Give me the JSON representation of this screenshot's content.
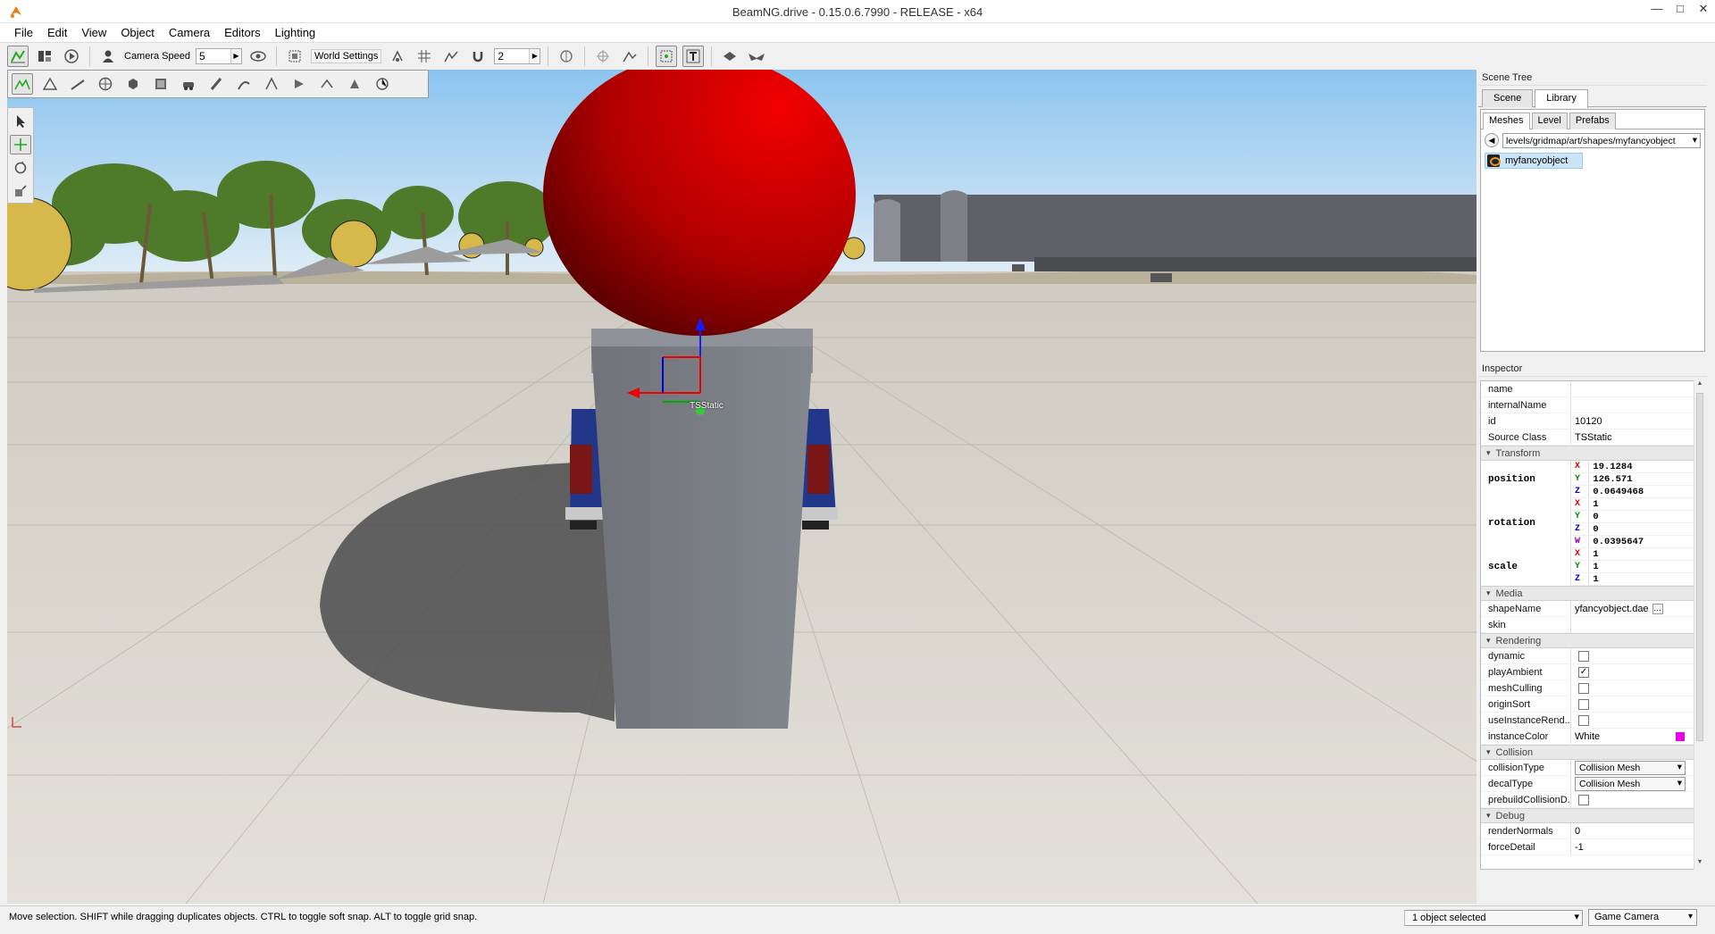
{
  "window": {
    "title": "BeamNG.drive - 0.15.0.6.7990 - RELEASE - x64",
    "controls": [
      "—",
      "□",
      "✕"
    ]
  },
  "menu": {
    "items": [
      "File",
      "Edit",
      "View",
      "Object",
      "Camera",
      "Editors",
      "Lighting"
    ]
  },
  "toolbar": {
    "camera_speed_label": "Camera Speed",
    "camera_speed_value": "5",
    "world_settings_label": "World Settings",
    "snap_value": "2"
  },
  "viewport": {
    "selection_label": "TSStatic"
  },
  "scene_tree": {
    "header": "Scene Tree",
    "tabs": [
      "Scene",
      "Library"
    ],
    "active_tab": "Library",
    "subtabs": [
      "Meshes",
      "Level",
      "Prefabs"
    ],
    "active_subtab": "Meshes",
    "path": "levels/gridmap/art/shapes/myfancyobject",
    "items": [
      "myfancyobject"
    ]
  },
  "inspector": {
    "header": "Inspector",
    "fields": {
      "name": {
        "label": "name",
        "value": ""
      },
      "internalName": {
        "label": "internalName",
        "value": ""
      },
      "id": {
        "label": "id",
        "value": "10120"
      },
      "sourceClass": {
        "label": "Source Class",
        "value": "TSStatic"
      }
    },
    "transform": {
      "group": "Transform",
      "position": {
        "label": "position",
        "x": "19.1284",
        "y": "126.571",
        "z": "0.0649468"
      },
      "rotation": {
        "label": "rotation",
        "x": "1",
        "y": "0",
        "z": "0",
        "w": "0.0395647"
      },
      "scale": {
        "label": "scale",
        "x": "1",
        "y": "1",
        "z": "1"
      }
    },
    "media": {
      "group": "Media",
      "shapeName": {
        "label": "shapeName",
        "value": "yfancyobject.dae"
      },
      "skin": {
        "label": "skin",
        "value": ""
      }
    },
    "rendering": {
      "group": "Rendering",
      "dynamic": {
        "label": "dynamic",
        "checked": false
      },
      "playAmbient": {
        "label": "playAmbient",
        "checked": true
      },
      "meshCulling": {
        "label": "meshCulling",
        "checked": false
      },
      "originSort": {
        "label": "originSort",
        "checked": false
      },
      "useInstanceRend": {
        "label": "useInstanceRend...",
        "checked": false
      },
      "instanceColor": {
        "label": "instanceColor",
        "value": "White",
        "swatch": "#e600e6"
      }
    },
    "collision": {
      "group": "Collision",
      "collisionType": {
        "label": "collisionType",
        "value": "Collision Mesh"
      },
      "decalType": {
        "label": "decalType",
        "value": "Collision Mesh"
      },
      "prebuildCollisionD": {
        "label": "prebuildCollisionD...",
        "checked": false
      }
    },
    "debug": {
      "group": "Debug",
      "renderNormals": {
        "label": "renderNormals",
        "value": "0"
      },
      "forceDetail": {
        "label": "forceDetail",
        "value": "-1"
      }
    }
  },
  "status": {
    "message": "Move selection.  SHIFT while dragging duplicates objects.  CTRL to toggle soft snap.  ALT to toggle grid snap.",
    "selection": "1 object selected",
    "camera_mode": "Game Camera"
  },
  "colors": {
    "sphere": "#c40000",
    "pillar": "#7b7f87",
    "sky": "#cfe6f7",
    "floor": "#d9d5cc",
    "accent_orange": "#e8801a"
  }
}
